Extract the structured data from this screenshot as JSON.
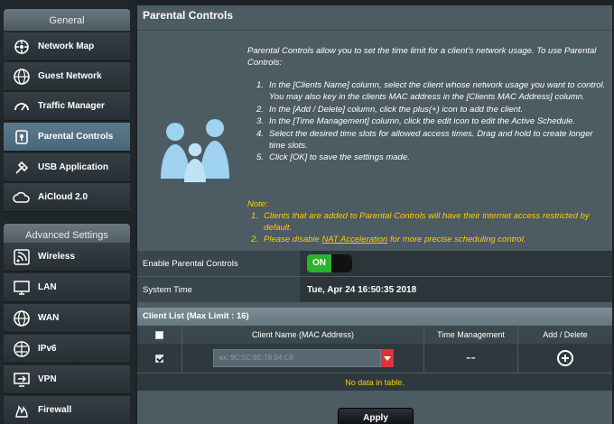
{
  "sidebar": {
    "general_label": "General",
    "advanced_label": "Advanced Settings",
    "general_items": [
      {
        "label": "Network Map",
        "icon": "network-map-icon"
      },
      {
        "label": "Guest Network",
        "icon": "guest-network-icon"
      },
      {
        "label": "Traffic Manager",
        "icon": "traffic-manager-icon"
      },
      {
        "label": "Parental Controls",
        "icon": "parental-controls-icon",
        "active": true
      },
      {
        "label": "USB Application",
        "icon": "usb-application-icon"
      },
      {
        "label": "AiCloud 2.0",
        "icon": "aicloud-icon"
      }
    ],
    "advanced_items": [
      {
        "label": "Wireless",
        "icon": "wireless-icon"
      },
      {
        "label": "LAN",
        "icon": "lan-icon"
      },
      {
        "label": "WAN",
        "icon": "wan-icon"
      },
      {
        "label": "IPv6",
        "icon": "ipv6-icon"
      },
      {
        "label": "VPN",
        "icon": "vpn-icon"
      },
      {
        "label": "Firewall",
        "icon": "firewall-icon"
      }
    ]
  },
  "main": {
    "title": "Parental Controls",
    "description": "Parental Controls allow you to set the time limit for a client's network usage. To use Parental Controls:",
    "steps": [
      {
        "num": "1.",
        "text": "In the [Clients Name] column, select the client whose network usage you want to control. You may also key in the clients MAC address in the [Clients MAC Address] column."
      },
      {
        "num": "2.",
        "text": "In the [Add / Delete] column, click the plus(+) icon to add the client."
      },
      {
        "num": "3.",
        "text": "In the [Time Management] column, click the edit icon to edit the Active Schedule."
      },
      {
        "num": "4.",
        "text": "Select the desired time slots for allowed access times. Drag and hold to create longer time slots."
      },
      {
        "num": "5.",
        "text": "Click [OK] to save the settings made."
      }
    ],
    "note_label": "Note:",
    "note1_num": "1.",
    "note1_text": "Clients that are added to Parental Controls will have their internet access restricted by default.",
    "note2_num": "2.",
    "note2_prefix": "Please disable ",
    "note2_link": "NAT Acceleration",
    "note2_suffix": " for more precise scheduling control.",
    "enable_label": "Enable Parental Controls",
    "toggle_label": "ON",
    "system_time_label": "System Time",
    "system_time_value": "Tue, Apr 24 16:50:35 2018",
    "client_list_title": "Client List (Max Limit : 16)",
    "columns": {
      "client_name": "Client Name (MAC Address)",
      "time_management": "Time Management",
      "add_delete": "Add / Delete"
    },
    "input_row": {
      "mac_value": "ex: 9C:5C:8E:78:94:C8",
      "time_management": "--"
    },
    "no_data": "No data in table.",
    "apply_label": "Apply"
  },
  "colors": {
    "accent_yellow": "#ffcc00",
    "toggle_green": "#2cb32c",
    "panel": "#4d5b63",
    "dropdown_red": "#e2303a"
  }
}
